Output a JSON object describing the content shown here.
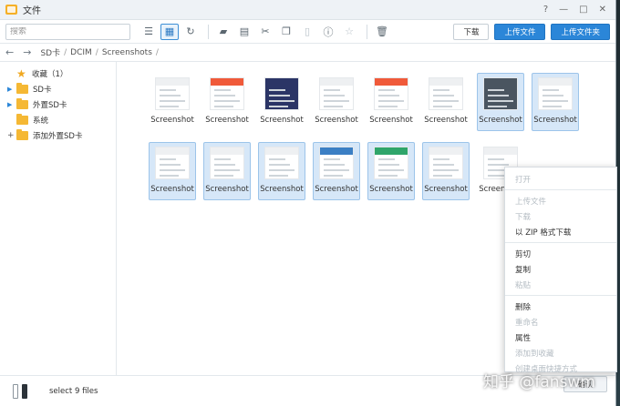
{
  "window": {
    "title": "文件",
    "controls": [
      "?",
      "—",
      "□",
      "✕"
    ]
  },
  "toolbar": {
    "search_placeholder": "搜索",
    "download_label": "下载",
    "upload_file_label": "上传文件",
    "upload_folder_label": "上传文件夹"
  },
  "pathbar": {
    "crumbs": [
      "SD卡",
      "DCIM",
      "Screenshots"
    ]
  },
  "sidebar": {
    "items": [
      {
        "label": "收藏（1）",
        "icon": "star-icon"
      },
      {
        "label": "SD卡",
        "icon": "folder-icon"
      },
      {
        "label": "外置SD卡",
        "icon": "folder-icon"
      },
      {
        "label": "系统",
        "icon": "folder-icon"
      },
      {
        "label": "添加外置SD卡",
        "icon": "folder-icon"
      }
    ]
  },
  "files": [
    {
      "name": "Screenshot",
      "selected": false,
      "color": "#eef0f2"
    },
    {
      "name": "Screenshot",
      "selected": false,
      "color": "#f05a3a"
    },
    {
      "name": "Screenshot",
      "selected": false,
      "color": "#2b3566"
    },
    {
      "name": "Screenshot",
      "selected": false,
      "color": "#eef0f2"
    },
    {
      "name": "Screenshot",
      "selected": false,
      "color": "#f05a3a"
    },
    {
      "name": "Screenshot",
      "selected": false,
      "color": "#eef0f2"
    },
    {
      "name": "Screenshot",
      "selected": true,
      "color": "#4a5560"
    },
    {
      "name": "Screenshot",
      "selected": true,
      "color": "#eef0f2"
    },
    {
      "name": "Screenshot",
      "selected": true,
      "color": "#eef0f2"
    },
    {
      "name": "Screenshot",
      "selected": true,
      "color": "#eef0f2"
    },
    {
      "name": "Screenshot",
      "selected": true,
      "color": "#eef0f2"
    },
    {
      "name": "Screenshot",
      "selected": true,
      "color": "#3b7fc4"
    },
    {
      "name": "Screenshot",
      "selected": true,
      "color": "#2fa56a"
    },
    {
      "name": "Screenshot",
      "selected": true,
      "color": "#eef0f2"
    },
    {
      "name": "Screenshot",
      "selected": false,
      "color": "#eef0f2"
    }
  ],
  "status": {
    "text": "select 9 files"
  },
  "context_menu": {
    "open": "打开",
    "upload": "上传文件",
    "download": "下载",
    "zip_download": "以 ZIP 格式下载",
    "cut": "剪切",
    "copy": "复制",
    "paste": "粘贴",
    "delete": "删除",
    "rename": "重命名",
    "properties": "属性",
    "add_favorite": "添加到收藏",
    "create_shortcut": "创建桌面快捷方式"
  },
  "watermark": "知乎 @fanswm",
  "ok_label": "确认"
}
